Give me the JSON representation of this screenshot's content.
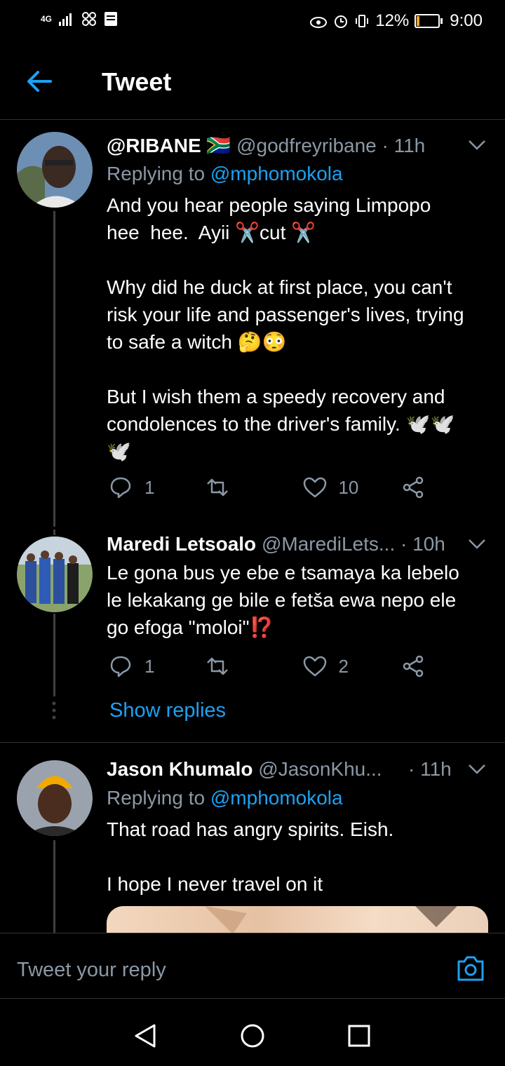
{
  "status_bar": {
    "network": "4G",
    "battery_percent": "12%",
    "battery_level": 0.12,
    "time": "9:00"
  },
  "header": {
    "title": "Tweet"
  },
  "tweets": [
    {
      "name": "@RIBANE",
      "flag": "🇿🇦",
      "handle": "@godfreyribane",
      "time": "· 11h",
      "replying_prefix": "Replying to",
      "replying_to": "@mphomokola",
      "text": "And you hear people saying Limpopo\nhee  hee.  Ayii ✂️cut ✂️\n\nWhy did he duck at first place, you can't\nrisk your life and passenger's lives, trying\nto safe a witch 🤔😳\n\nBut I wish them a speedy recovery and\ncondolences to the driver's family. 🕊️🕊️\n🕊️",
      "replies": "1",
      "likes": "10"
    },
    {
      "name": "Maredi Letsoalo",
      "handle": "@MarediLets...",
      "time": "· 10h",
      "text": "Le gona bus ye ebe e tsamaya ka lebelo\nle lekakang ge bile e fetša ewa nepo ele\ngo efoga \"moloi\"⁉️",
      "replies": "1",
      "likes": "2",
      "show_replies": "Show replies"
    },
    {
      "name": "Jason Khumalo",
      "handle": "@JasonKhu...",
      "time": "· 11h",
      "replying_prefix": "Replying to",
      "replying_to": "@mphomokola",
      "text": "That road has angry spirits. Eish.\n\nI hope I never travel on it"
    }
  ],
  "reply_box": {
    "placeholder": "Tweet your reply"
  },
  "colors": {
    "accent": "#1da1f2",
    "muted": "#8b98a5",
    "background": "#000000",
    "divider": "#2f3336"
  }
}
